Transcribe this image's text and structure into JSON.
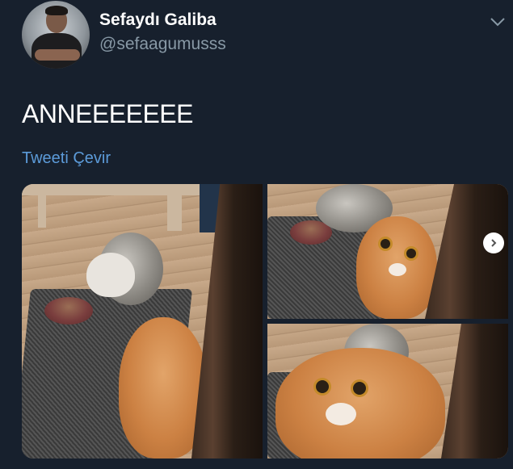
{
  "tweet": {
    "display_name": "Sefaydı Galiba",
    "handle": "@sefaagumusss",
    "text": "ANNEEEEEEE",
    "translate_label": "Tweeti Çevir"
  },
  "icons": {
    "menu": "chevron-down-icon",
    "next": "chevron-right-icon"
  },
  "colors": {
    "background": "#17202d",
    "link": "#5c9bd9",
    "secondary_text": "#8899a6"
  }
}
